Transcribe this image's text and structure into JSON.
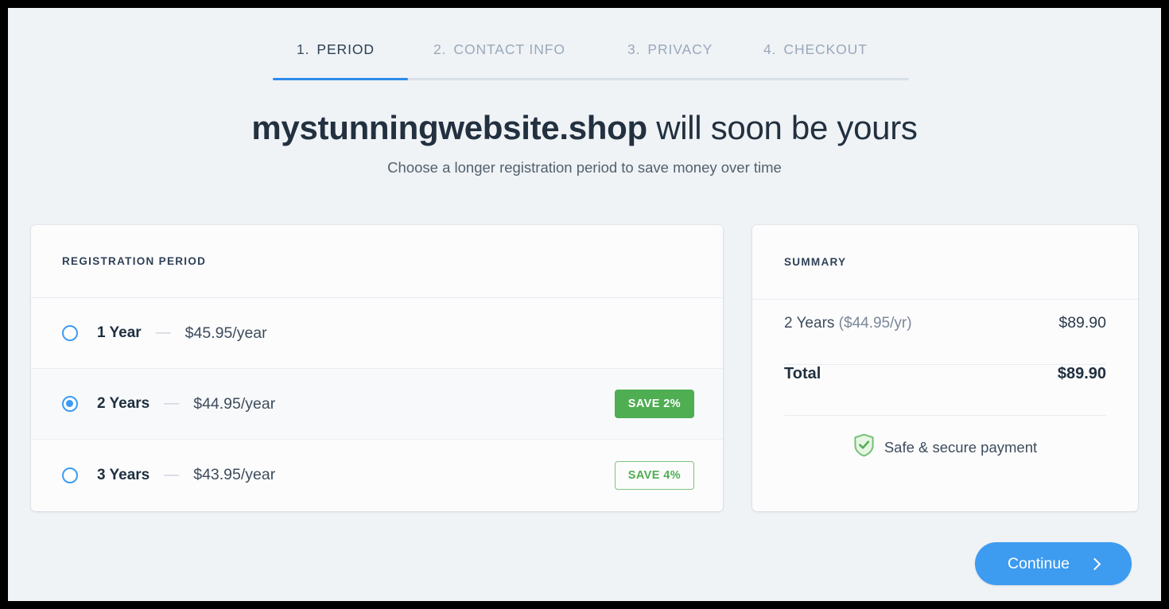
{
  "steps": {
    "items": [
      {
        "number": "1.",
        "label": "PERIOD",
        "active": true
      },
      {
        "number": "2.",
        "label": "CONTACT INFO",
        "active": false
      },
      {
        "number": "3.",
        "label": "PRIVACY",
        "active": false
      },
      {
        "number": "4.",
        "label": "CHECKOUT",
        "active": false
      }
    ],
    "progress_percent": 21
  },
  "heading": {
    "domain": "mystunningwebsite.shop",
    "rest": " will soon be yours",
    "subtitle": "Choose a longer registration period to save money over time"
  },
  "period_card": {
    "title": "REGISTRATION PERIOD",
    "rows": [
      {
        "term": "1 Year",
        "dash": "—",
        "price": "$45.95/year",
        "selected": false,
        "badge": null
      },
      {
        "term": "2 Years",
        "dash": "—",
        "price": "$44.95/year",
        "selected": true,
        "badge": "SAVE 2%"
      },
      {
        "term": "3 Years",
        "dash": "—",
        "price": "$43.95/year",
        "selected": false,
        "badge": "SAVE 4%"
      }
    ]
  },
  "summary_card": {
    "title": "SUMMARY",
    "item_label": "2 Years ",
    "item_rate": "($44.95/yr)",
    "item_amount": "$89.90",
    "total_label": "Total",
    "total_amount": "$89.90",
    "secure_text": "Safe & secure payment"
  },
  "continue": {
    "label": "Continue"
  },
  "colors": {
    "accent_blue": "#3d9bf0",
    "progress_blue": "#2d8bea",
    "green": "#4fad52",
    "page_bg": "#eff3f6",
    "card_bg": "#fcfcfd",
    "text_dark": "#1f2f3f",
    "text_muted": "#9aa8bb"
  }
}
